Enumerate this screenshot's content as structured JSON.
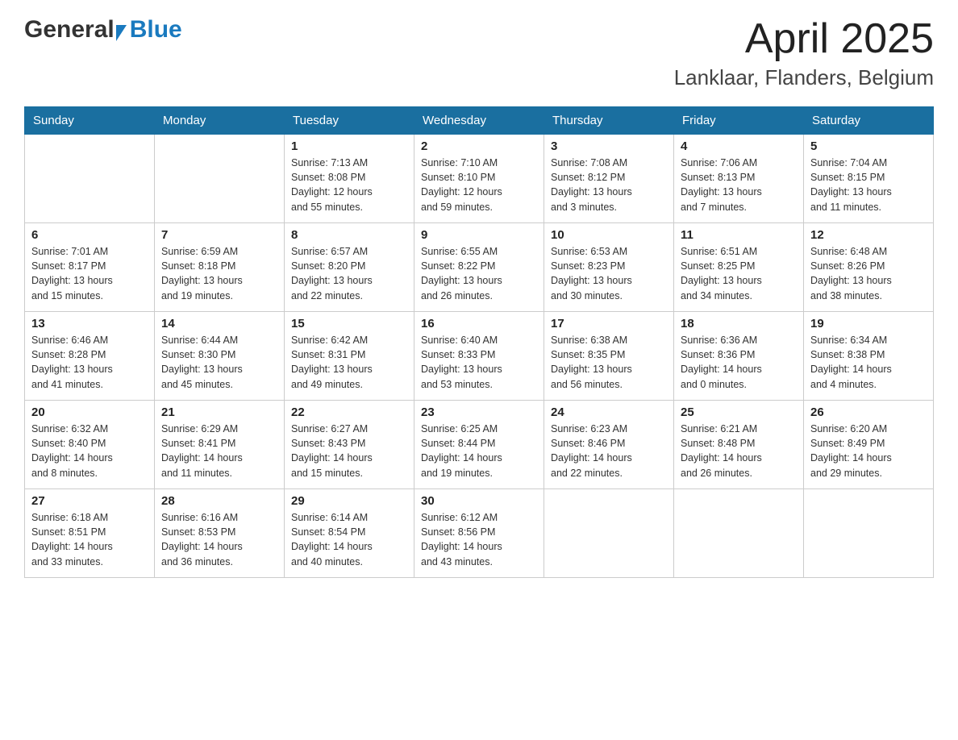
{
  "header": {
    "title": "April 2025",
    "subtitle": "Lanklaar, Flanders, Belgium",
    "logo": {
      "general": "General",
      "blue": "Blue"
    }
  },
  "calendar": {
    "days_of_week": [
      "Sunday",
      "Monday",
      "Tuesday",
      "Wednesday",
      "Thursday",
      "Friday",
      "Saturday"
    ],
    "weeks": [
      [
        {
          "day": "",
          "info": ""
        },
        {
          "day": "",
          "info": ""
        },
        {
          "day": "1",
          "info": "Sunrise: 7:13 AM\nSunset: 8:08 PM\nDaylight: 12 hours\nand 55 minutes."
        },
        {
          "day": "2",
          "info": "Sunrise: 7:10 AM\nSunset: 8:10 PM\nDaylight: 12 hours\nand 59 minutes."
        },
        {
          "day": "3",
          "info": "Sunrise: 7:08 AM\nSunset: 8:12 PM\nDaylight: 13 hours\nand 3 minutes."
        },
        {
          "day": "4",
          "info": "Sunrise: 7:06 AM\nSunset: 8:13 PM\nDaylight: 13 hours\nand 7 minutes."
        },
        {
          "day": "5",
          "info": "Sunrise: 7:04 AM\nSunset: 8:15 PM\nDaylight: 13 hours\nand 11 minutes."
        }
      ],
      [
        {
          "day": "6",
          "info": "Sunrise: 7:01 AM\nSunset: 8:17 PM\nDaylight: 13 hours\nand 15 minutes."
        },
        {
          "day": "7",
          "info": "Sunrise: 6:59 AM\nSunset: 8:18 PM\nDaylight: 13 hours\nand 19 minutes."
        },
        {
          "day": "8",
          "info": "Sunrise: 6:57 AM\nSunset: 8:20 PM\nDaylight: 13 hours\nand 22 minutes."
        },
        {
          "day": "9",
          "info": "Sunrise: 6:55 AM\nSunset: 8:22 PM\nDaylight: 13 hours\nand 26 minutes."
        },
        {
          "day": "10",
          "info": "Sunrise: 6:53 AM\nSunset: 8:23 PM\nDaylight: 13 hours\nand 30 minutes."
        },
        {
          "day": "11",
          "info": "Sunrise: 6:51 AM\nSunset: 8:25 PM\nDaylight: 13 hours\nand 34 minutes."
        },
        {
          "day": "12",
          "info": "Sunrise: 6:48 AM\nSunset: 8:26 PM\nDaylight: 13 hours\nand 38 minutes."
        }
      ],
      [
        {
          "day": "13",
          "info": "Sunrise: 6:46 AM\nSunset: 8:28 PM\nDaylight: 13 hours\nand 41 minutes."
        },
        {
          "day": "14",
          "info": "Sunrise: 6:44 AM\nSunset: 8:30 PM\nDaylight: 13 hours\nand 45 minutes."
        },
        {
          "day": "15",
          "info": "Sunrise: 6:42 AM\nSunset: 8:31 PM\nDaylight: 13 hours\nand 49 minutes."
        },
        {
          "day": "16",
          "info": "Sunrise: 6:40 AM\nSunset: 8:33 PM\nDaylight: 13 hours\nand 53 minutes."
        },
        {
          "day": "17",
          "info": "Sunrise: 6:38 AM\nSunset: 8:35 PM\nDaylight: 13 hours\nand 56 minutes."
        },
        {
          "day": "18",
          "info": "Sunrise: 6:36 AM\nSunset: 8:36 PM\nDaylight: 14 hours\nand 0 minutes."
        },
        {
          "day": "19",
          "info": "Sunrise: 6:34 AM\nSunset: 8:38 PM\nDaylight: 14 hours\nand 4 minutes."
        }
      ],
      [
        {
          "day": "20",
          "info": "Sunrise: 6:32 AM\nSunset: 8:40 PM\nDaylight: 14 hours\nand 8 minutes."
        },
        {
          "day": "21",
          "info": "Sunrise: 6:29 AM\nSunset: 8:41 PM\nDaylight: 14 hours\nand 11 minutes."
        },
        {
          "day": "22",
          "info": "Sunrise: 6:27 AM\nSunset: 8:43 PM\nDaylight: 14 hours\nand 15 minutes."
        },
        {
          "day": "23",
          "info": "Sunrise: 6:25 AM\nSunset: 8:44 PM\nDaylight: 14 hours\nand 19 minutes."
        },
        {
          "day": "24",
          "info": "Sunrise: 6:23 AM\nSunset: 8:46 PM\nDaylight: 14 hours\nand 22 minutes."
        },
        {
          "day": "25",
          "info": "Sunrise: 6:21 AM\nSunset: 8:48 PM\nDaylight: 14 hours\nand 26 minutes."
        },
        {
          "day": "26",
          "info": "Sunrise: 6:20 AM\nSunset: 8:49 PM\nDaylight: 14 hours\nand 29 minutes."
        }
      ],
      [
        {
          "day": "27",
          "info": "Sunrise: 6:18 AM\nSunset: 8:51 PM\nDaylight: 14 hours\nand 33 minutes."
        },
        {
          "day": "28",
          "info": "Sunrise: 6:16 AM\nSunset: 8:53 PM\nDaylight: 14 hours\nand 36 minutes."
        },
        {
          "day": "29",
          "info": "Sunrise: 6:14 AM\nSunset: 8:54 PM\nDaylight: 14 hours\nand 40 minutes."
        },
        {
          "day": "30",
          "info": "Sunrise: 6:12 AM\nSunset: 8:56 PM\nDaylight: 14 hours\nand 43 minutes."
        },
        {
          "day": "",
          "info": ""
        },
        {
          "day": "",
          "info": ""
        },
        {
          "day": "",
          "info": ""
        }
      ]
    ]
  }
}
